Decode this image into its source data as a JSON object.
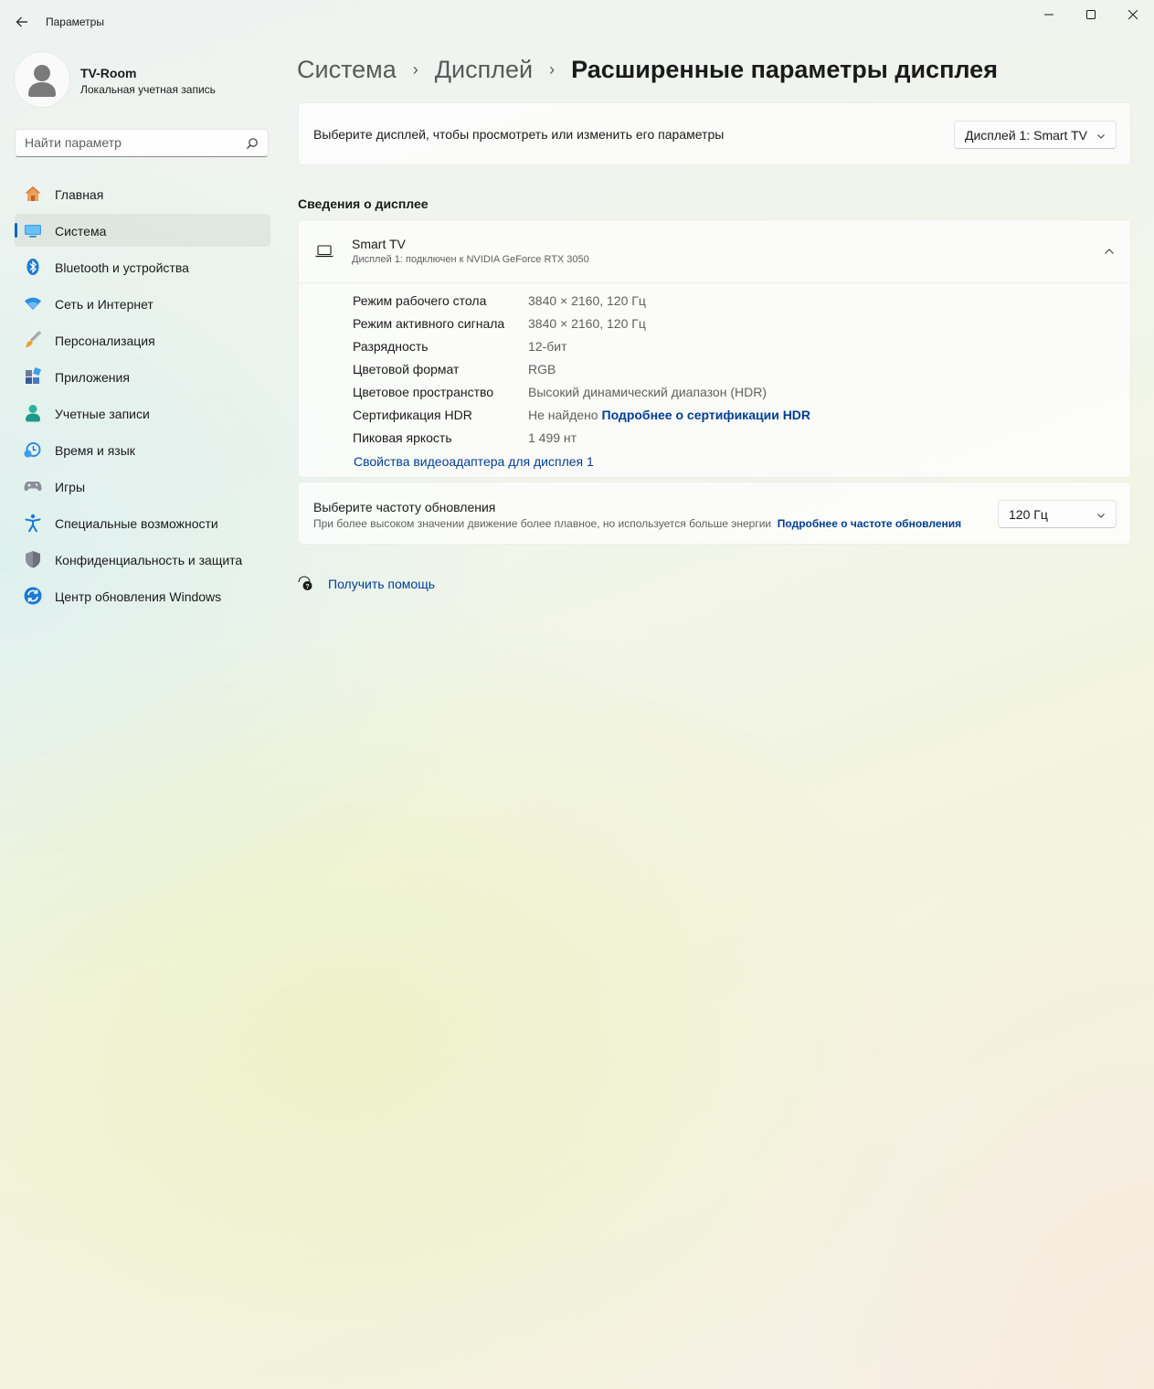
{
  "window": {
    "title": "Параметры"
  },
  "user": {
    "name": "TV-Room",
    "account_type": "Локальная учетная запись"
  },
  "search": {
    "placeholder": "Найти параметр"
  },
  "sidebar": {
    "items": [
      {
        "label": "Главная",
        "icon": "home-icon"
      },
      {
        "label": "Система",
        "icon": "system-icon",
        "active": true
      },
      {
        "label": "Bluetooth и устройства",
        "icon": "bluetooth-icon"
      },
      {
        "label": "Сеть и Интернет",
        "icon": "wifi-icon"
      },
      {
        "label": "Персонализация",
        "icon": "brush-icon"
      },
      {
        "label": "Приложения",
        "icon": "apps-icon"
      },
      {
        "label": "Учетные записи",
        "icon": "accounts-icon"
      },
      {
        "label": "Время и язык",
        "icon": "time-language-icon"
      },
      {
        "label": "Игры",
        "icon": "gamepad-icon"
      },
      {
        "label": "Специальные возможности",
        "icon": "accessibility-icon"
      },
      {
        "label": "Конфиденциальность и защита",
        "icon": "shield-icon"
      },
      {
        "label": "Центр обновления Windows",
        "icon": "update-icon"
      }
    ]
  },
  "breadcrumb": {
    "parts": [
      "Система",
      "Дисплей"
    ],
    "current": "Расширенные параметры дисплея",
    "separator": "›"
  },
  "display_select": {
    "label": "Выберите дисплей, чтобы просмотреть или изменить его параметры",
    "value": "Дисплей 1: Smart TV"
  },
  "display_info": {
    "section_title": "Сведения о дисплее",
    "name": "Smart TV",
    "subtitle": "Дисплей 1: подключен к NVIDIA GeForce RTX 3050",
    "rows": [
      {
        "key": "Режим рабочего стола",
        "value": "3840 × 2160, 120 Гц"
      },
      {
        "key": "Режим активного сигнала",
        "value": "3840 × 2160, 120 Гц"
      },
      {
        "key": "Разрядность",
        "value": "12-бит"
      },
      {
        "key": "Цветовой формат",
        "value": "RGB"
      },
      {
        "key": "Цветовое пространство",
        "value": "Высокий динамический диапазон (HDR)"
      },
      {
        "key": "Сертификация HDR",
        "value": "Не найдено",
        "link": "Подробнее о сертификации HDR"
      },
      {
        "key": "Пиковая яркость",
        "value": "1 499 нт"
      }
    ],
    "adapter_link": "Свойства видеоадаптера для дисплея 1"
  },
  "refresh_rate": {
    "title": "Выберите частоту обновления",
    "description": "При более высоком значении движение более плавное, но используется больше энергии",
    "link": "Подробнее о частоте обновления",
    "value": "120 Гц"
  },
  "help": {
    "label": "Получить помощь"
  },
  "colors": {
    "accent": "#0067c0",
    "link": "#003e92"
  }
}
